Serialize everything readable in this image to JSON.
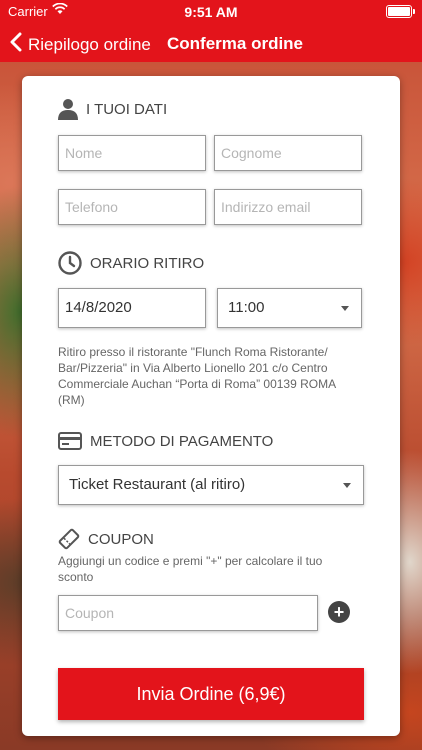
{
  "status_bar": {
    "carrier": "Carrier",
    "time": "9:51 AM"
  },
  "nav": {
    "back_label": "Riepilogo ordine",
    "title": "Conferma ordine"
  },
  "dati": {
    "title": "I TUOI DATI",
    "nome_placeholder": "Nome",
    "cognome_placeholder": "Cognome",
    "telefono_placeholder": "Telefono",
    "email_placeholder": "Indirizzo email"
  },
  "ritiro": {
    "title": "ORARIO RITIRO",
    "date": "14/8/2020",
    "time": "11:00",
    "note": "Ritiro presso il ristorante \"Flunch Roma Ristorante/ Bar/Pizzeria\" in Via Alberto Lionello 201 c/o Centro Commerciale Auchan “Porta di Roma”  00139 ROMA (RM)"
  },
  "pagamento": {
    "title": "METODO DI PAGAMENTO",
    "selected": "Ticket Restaurant (al ritiro)"
  },
  "coupon": {
    "title": "COUPON",
    "hint": "Aggiungi un codice e premi \"+\" per calcolare il tuo sconto",
    "placeholder": "Coupon",
    "add_symbol": "+"
  },
  "submit_label": "Invia Ordine (6,9€)",
  "colors": {
    "accent": "#e3141b"
  },
  "icons": [
    "back-chevron-icon",
    "wifi-icon",
    "battery-icon",
    "user-icon",
    "clock-icon",
    "credit-card-icon",
    "ticket-icon",
    "plus-circle-icon",
    "caret-down-icon"
  ]
}
